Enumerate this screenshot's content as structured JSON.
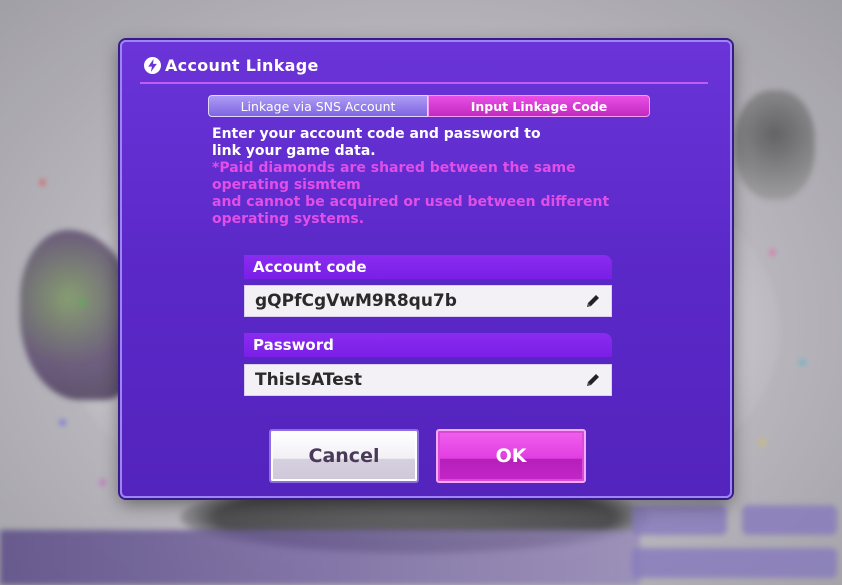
{
  "dialog": {
    "title": "Account Linkage",
    "tabs": [
      {
        "label": "Linkage via SNS Account",
        "active": false
      },
      {
        "label": "Input Linkage Code",
        "active": true
      }
    ],
    "instructions": {
      "line1": "Enter your account code and password to",
      "line2": "link your game data.",
      "note1": "*Paid diamonds are shared between the same",
      "note2": "operating sismtem",
      "note3": "and cannot be acquired or used between different",
      "note4": "operating systems."
    },
    "account_code": {
      "label": "Account code",
      "value": "gQPfCgVwM9R8qu7b"
    },
    "password": {
      "label": "Password",
      "value": "ThisIsATest"
    },
    "buttons": {
      "cancel": "Cancel",
      "ok": "OK"
    }
  },
  "icons": {
    "title": "bolt-icon",
    "edit": "pencil-icon"
  },
  "colors": {
    "dialog_bg": "#5b28c8",
    "accent_magenta": "#e03ee0",
    "note_text": "#e14fe6",
    "field_label": "#7a1fe6"
  }
}
